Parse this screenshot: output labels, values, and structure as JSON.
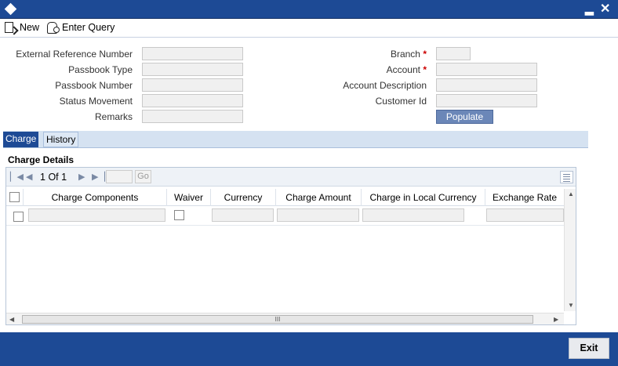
{
  "window": {
    "minimize_icon": "minimize-icon",
    "close_icon": "close-icon",
    "minimize_glyph": "▂",
    "close_glyph": "✕"
  },
  "toolbar": {
    "new_label": "New",
    "enter_query_label": "Enter Query"
  },
  "form": {
    "external_reference_number": {
      "label": "External Reference Number",
      "value": ""
    },
    "passbook_type": {
      "label": "Passbook Type",
      "value": ""
    },
    "passbook_number": {
      "label": "Passbook Number",
      "value": ""
    },
    "status_movement": {
      "label": "Status Movement",
      "value": ""
    },
    "remarks": {
      "label": "Remarks",
      "value": ""
    },
    "branch": {
      "label": "Branch",
      "required_mark": "*",
      "value": ""
    },
    "account": {
      "label": "Account",
      "required_mark": "*",
      "value": ""
    },
    "account_description": {
      "label": "Account Description",
      "value": ""
    },
    "customer_id": {
      "label": "Customer Id",
      "value": ""
    },
    "populate_label": "Populate"
  },
  "tabs": [
    {
      "label": "Charge",
      "active": true
    },
    {
      "label": "History",
      "active": false
    }
  ],
  "charge_details": {
    "title": "Charge Details",
    "pager": {
      "current": "1",
      "of_label": "Of",
      "total": "1",
      "go_label": "Go"
    },
    "columns": [
      "Charge Components",
      "Waiver",
      "Currency",
      "Charge Amount",
      "Charge in Local Currency",
      "Exchange Rate"
    ],
    "scroll_grip": "III"
  },
  "footer": {
    "exit_label": "Exit"
  },
  "colors": {
    "titlebar": "#1d4a95",
    "tab_active": "#1d4a95",
    "required": "#cc0000"
  }
}
